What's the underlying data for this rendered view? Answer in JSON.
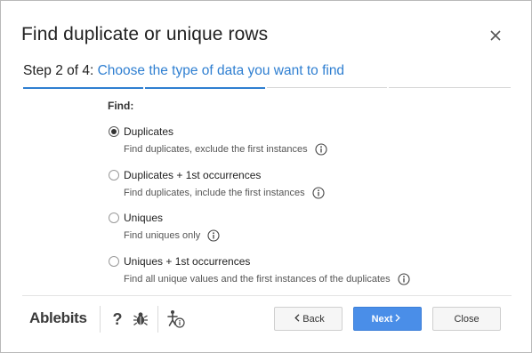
{
  "dialog": {
    "title": "Find duplicate or unique rows",
    "close_icon": "close-icon"
  },
  "step": {
    "prefix": "Step 2 of 4:",
    "description": "Choose the type of data you want to find",
    "current": 2,
    "total": 4
  },
  "find": {
    "label": "Find:",
    "options": [
      {
        "label": "Duplicates",
        "description": "Find duplicates, exclude the first instances",
        "selected": true
      },
      {
        "label": "Duplicates + 1st occurrences",
        "description": "Find duplicates, include the first instances",
        "selected": false
      },
      {
        "label": "Uniques",
        "description": "Find uniques only",
        "selected": false
      },
      {
        "label": "Uniques + 1st occurrences",
        "description": "Find all unique values and the first instances of the duplicates",
        "selected": false
      }
    ]
  },
  "footer": {
    "brand": "Ablebits",
    "icons": [
      "help-icon",
      "bug-icon",
      "accessibility-info-icon"
    ],
    "back_label": "Back",
    "next_label": "Next",
    "close_label": "Close"
  },
  "colors": {
    "accent": "#2f7fd1",
    "primary_button": "#4a8ee8"
  }
}
